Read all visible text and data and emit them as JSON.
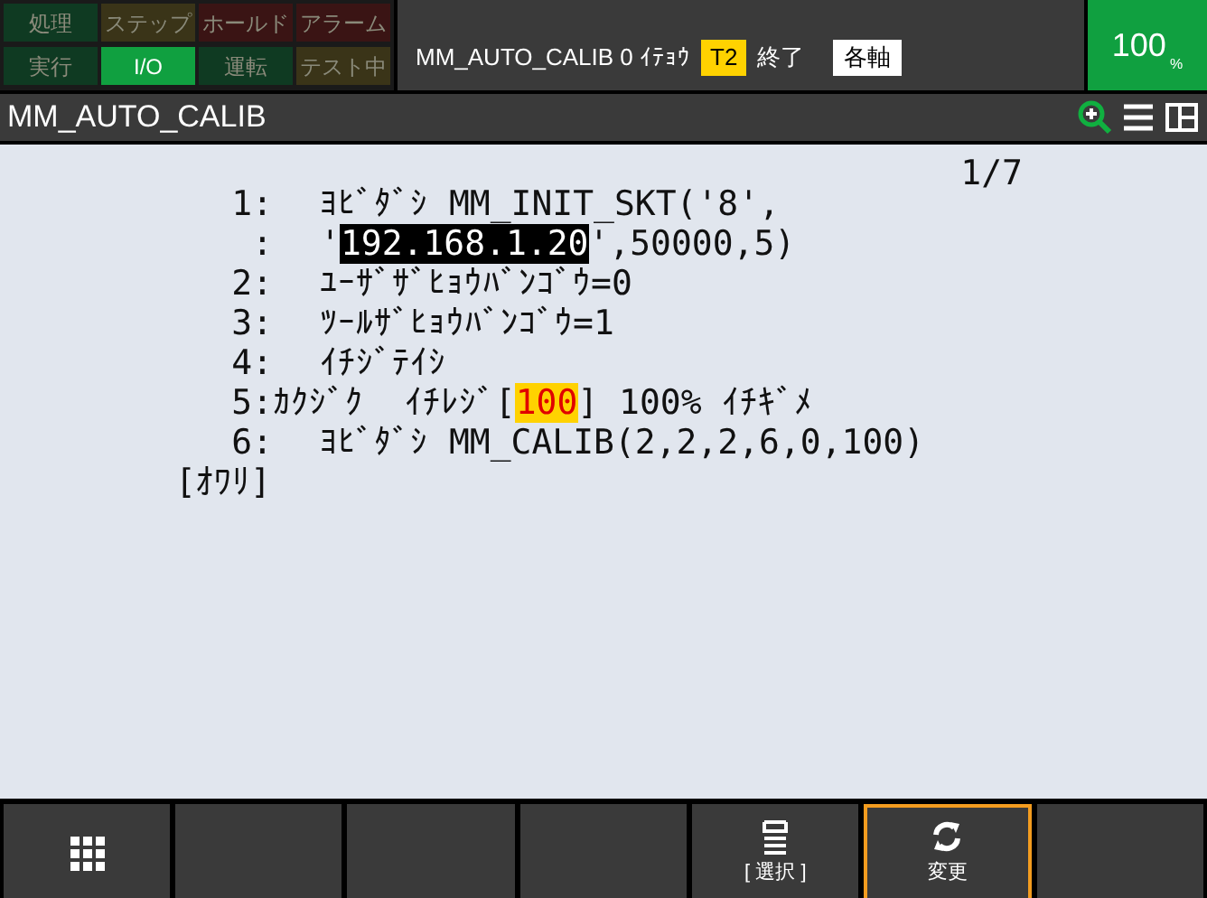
{
  "status_lamps": [
    {
      "label": "処理",
      "color": "#0f3a22",
      "on": false
    },
    {
      "label": "ステップ",
      "color": "#3a3418",
      "on": false
    },
    {
      "label": "ホールド",
      "color": "#3a1414",
      "on": false
    },
    {
      "label": "アラーム",
      "color": "#3a1414",
      "on": false
    },
    {
      "label": "実行",
      "color": "#0f3a22",
      "on": false
    },
    {
      "label": "I/O",
      "color": "#10a040",
      "on": true
    },
    {
      "label": "運転",
      "color": "#0f3a22",
      "on": false
    },
    {
      "label": "テスト中",
      "color": "#3a3418",
      "on": false
    }
  ],
  "status_line": {
    "program": "MM_AUTO_CALIB 0 ｲﾃｮｳ",
    "mode": "T2",
    "state": "終了",
    "coord": "各軸"
  },
  "override": {
    "value": "100",
    "unit": "%"
  },
  "title_bar": {
    "title": "MM_AUTO_CALIB"
  },
  "editor": {
    "page": "1/7",
    "lines": [
      {
        "number": "1:",
        "kind": "statement",
        "segments": [
          {
            "text": "ﾖﾋﾞﾀﾞｼ MM_INIT_SKT('8',",
            "kind": "plain"
          }
        ]
      },
      {
        "number": ":",
        "kind": "statement",
        "segments": [
          {
            "text": "'",
            "kind": "plain"
          },
          {
            "text": "192.168.1.20",
            "kind": "cursor"
          },
          {
            "text": "',50000,5)",
            "kind": "plain"
          }
        ]
      },
      {
        "number": "2:",
        "kind": "statement",
        "segments": [
          {
            "text": "ﾕｰｻﾞｻﾞﾋｮｳﾊﾞﾝｺﾞｳ=0",
            "kind": "plain"
          }
        ]
      },
      {
        "number": "3:",
        "kind": "statement",
        "segments": [
          {
            "text": "ﾂｰﾙｻﾞﾋｮｳﾊﾞﾝｺﾞｳ=1",
            "kind": "plain"
          }
        ]
      },
      {
        "number": "4:",
        "kind": "statement",
        "segments": [
          {
            "text": "ｲﾁｼﾞﾃｲｼ",
            "kind": "plain"
          }
        ]
      },
      {
        "number": "5:",
        "kind": "motion",
        "segments": [
          {
            "text": "ｶｸｼﾞｸ  ｲﾁﾚｼﾞ[",
            "kind": "plain"
          },
          {
            "text": "100",
            "kind": "value"
          },
          {
            "text": "] 100% ｲﾁｷﾞﾒ",
            "kind": "plain"
          }
        ]
      },
      {
        "number": "6:",
        "kind": "statement",
        "segments": [
          {
            "text": "ﾖﾋﾞﾀﾞｼ MM_CALIB(2,2,2,6,0,100)",
            "kind": "plain"
          }
        ]
      }
    ],
    "end_marker": "[ｵﾜﾘ]"
  },
  "function_keys": [
    {
      "kind": "menu",
      "selected": false
    },
    {
      "selected": false
    },
    {
      "selected": false
    },
    {
      "selected": false
    },
    {
      "label": "[ 選択 ]",
      "kind": "select",
      "selected": false
    },
    {
      "label": "変更",
      "kind": "change",
      "selected": true
    },
    {
      "selected": false
    }
  ]
}
